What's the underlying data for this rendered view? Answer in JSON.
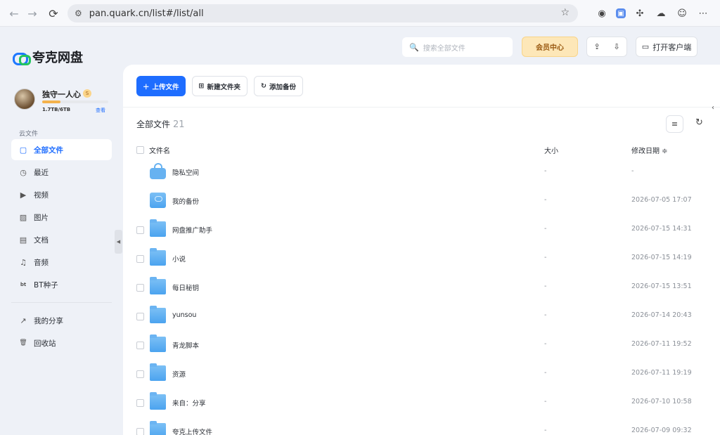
{
  "browser": {
    "url": "pan.quark.cn/list#/list/all",
    "back_icon": "←",
    "forward_icon": "→",
    "reload_icon": "⟳"
  },
  "logo": {
    "text": "夸克网盘"
  },
  "user": {
    "name": "独守一人心",
    "vip_level": "S",
    "quota": "1.7TB/6TB",
    "quota_fraction": 0.28,
    "quota_link": "查看"
  },
  "sidebar": {
    "section_label": "云文件",
    "items": [
      {
        "label": "全部文件",
        "icon": "▢",
        "active": true
      },
      {
        "label": "最近",
        "icon": "◷"
      },
      {
        "label": "视频",
        "icon": "▶"
      },
      {
        "label": "图片",
        "icon": "▨"
      },
      {
        "label": "文档",
        "icon": "▤"
      },
      {
        "label": "音频",
        "icon": "♫"
      },
      {
        "label": "BT种子",
        "icon": "bt"
      }
    ],
    "extra_items": [
      {
        "label": "我的分享",
        "icon": "↗"
      },
      {
        "label": "回收站",
        "icon": "🗑"
      }
    ]
  },
  "header": {
    "search_placeholder": "搜索全部文件",
    "vip_button": "会员中心",
    "client_button": "打开客户端"
  },
  "toolbar": {
    "upload": "上传文件",
    "new_folder": "新建文件夹",
    "add_backup": "添加备份"
  },
  "breadcrumb": {
    "title": "全部文件",
    "count": "21"
  },
  "table": {
    "col_name": "文件名",
    "col_size": "大小",
    "col_date": "修改日期 ≑",
    "rows": [
      {
        "name": "隐私空间",
        "size": "-",
        "date": "-",
        "icon": "lock",
        "checkbox": false
      },
      {
        "name": "我的备份",
        "size": "-",
        "date": "2026-07-05 17:07",
        "icon": "drive",
        "checkbox": false
      },
      {
        "name": "网盘推广助手",
        "size": "-",
        "date": "2026-07-15 14:31",
        "icon": "folder",
        "checkbox": true
      },
      {
        "name": "小说",
        "size": "-",
        "date": "2026-07-15 14:19",
        "icon": "folder",
        "checkbox": true
      },
      {
        "name": "每日秘钥",
        "size": "-",
        "date": "2026-07-15 13:51",
        "icon": "folder",
        "checkbox": true
      },
      {
        "name": "yunsou",
        "size": "-",
        "date": "2026-07-14 20:43",
        "icon": "folder",
        "checkbox": true
      },
      {
        "name": "青龙脚本",
        "size": "-",
        "date": "2026-07-11 19:52",
        "icon": "folder",
        "checkbox": true
      },
      {
        "name": "资源",
        "size": "-",
        "date": "2026-07-11 19:19",
        "icon": "folder",
        "checkbox": true
      },
      {
        "name": "来自：分享",
        "size": "-",
        "date": "2026-07-10 10:58",
        "icon": "folder",
        "checkbox": true
      },
      {
        "name": "夸克上传文件",
        "size": "-",
        "date": "2026-07-09 09:32",
        "icon": "folder",
        "checkbox": true
      }
    ]
  }
}
